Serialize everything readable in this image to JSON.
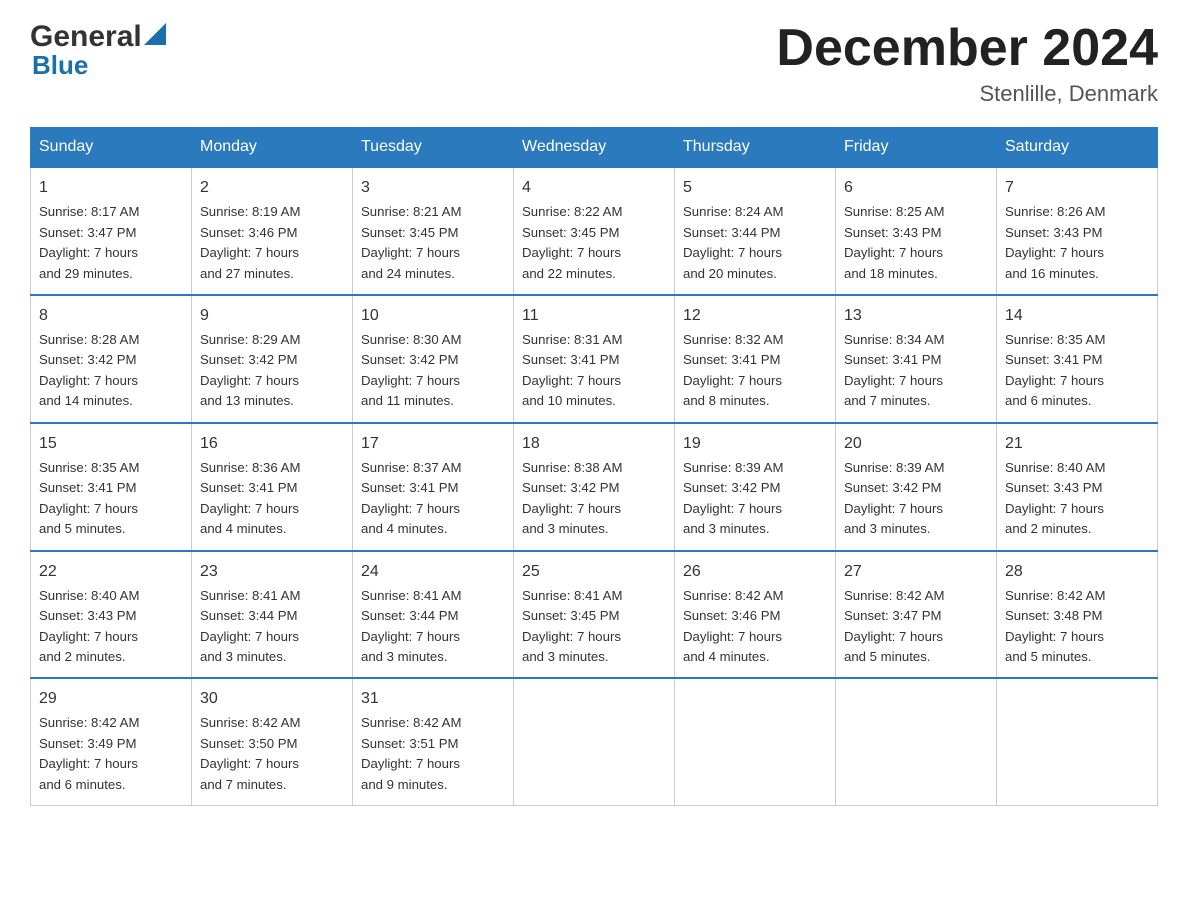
{
  "header": {
    "logo_general": "General",
    "logo_blue": "Blue",
    "month_title": "December 2024",
    "location": "Stenlille, Denmark"
  },
  "days_of_week": [
    "Sunday",
    "Monday",
    "Tuesday",
    "Wednesday",
    "Thursday",
    "Friday",
    "Saturday"
  ],
  "weeks": [
    [
      {
        "day": "1",
        "sunrise": "8:17 AM",
        "sunset": "3:47 PM",
        "daylight": "7 hours and 29 minutes."
      },
      {
        "day": "2",
        "sunrise": "8:19 AM",
        "sunset": "3:46 PM",
        "daylight": "7 hours and 27 minutes."
      },
      {
        "day": "3",
        "sunrise": "8:21 AM",
        "sunset": "3:45 PM",
        "daylight": "7 hours and 24 minutes."
      },
      {
        "day": "4",
        "sunrise": "8:22 AM",
        "sunset": "3:45 PM",
        "daylight": "7 hours and 22 minutes."
      },
      {
        "day": "5",
        "sunrise": "8:24 AM",
        "sunset": "3:44 PM",
        "daylight": "7 hours and 20 minutes."
      },
      {
        "day": "6",
        "sunrise": "8:25 AM",
        "sunset": "3:43 PM",
        "daylight": "7 hours and 18 minutes."
      },
      {
        "day": "7",
        "sunrise": "8:26 AM",
        "sunset": "3:43 PM",
        "daylight": "7 hours and 16 minutes."
      }
    ],
    [
      {
        "day": "8",
        "sunrise": "8:28 AM",
        "sunset": "3:42 PM",
        "daylight": "7 hours and 14 minutes."
      },
      {
        "day": "9",
        "sunrise": "8:29 AM",
        "sunset": "3:42 PM",
        "daylight": "7 hours and 13 minutes."
      },
      {
        "day": "10",
        "sunrise": "8:30 AM",
        "sunset": "3:42 PM",
        "daylight": "7 hours and 11 minutes."
      },
      {
        "day": "11",
        "sunrise": "8:31 AM",
        "sunset": "3:41 PM",
        "daylight": "7 hours and 10 minutes."
      },
      {
        "day": "12",
        "sunrise": "8:32 AM",
        "sunset": "3:41 PM",
        "daylight": "7 hours and 8 minutes."
      },
      {
        "day": "13",
        "sunrise": "8:34 AM",
        "sunset": "3:41 PM",
        "daylight": "7 hours and 7 minutes."
      },
      {
        "day": "14",
        "sunrise": "8:35 AM",
        "sunset": "3:41 PM",
        "daylight": "7 hours and 6 minutes."
      }
    ],
    [
      {
        "day": "15",
        "sunrise": "8:35 AM",
        "sunset": "3:41 PM",
        "daylight": "7 hours and 5 minutes."
      },
      {
        "day": "16",
        "sunrise": "8:36 AM",
        "sunset": "3:41 PM",
        "daylight": "7 hours and 4 minutes."
      },
      {
        "day": "17",
        "sunrise": "8:37 AM",
        "sunset": "3:41 PM",
        "daylight": "7 hours and 4 minutes."
      },
      {
        "day": "18",
        "sunrise": "8:38 AM",
        "sunset": "3:42 PM",
        "daylight": "7 hours and 3 minutes."
      },
      {
        "day": "19",
        "sunrise": "8:39 AM",
        "sunset": "3:42 PM",
        "daylight": "7 hours and 3 minutes."
      },
      {
        "day": "20",
        "sunrise": "8:39 AM",
        "sunset": "3:42 PM",
        "daylight": "7 hours and 3 minutes."
      },
      {
        "day": "21",
        "sunrise": "8:40 AM",
        "sunset": "3:43 PM",
        "daylight": "7 hours and 2 minutes."
      }
    ],
    [
      {
        "day": "22",
        "sunrise": "8:40 AM",
        "sunset": "3:43 PM",
        "daylight": "7 hours and 2 minutes."
      },
      {
        "day": "23",
        "sunrise": "8:41 AM",
        "sunset": "3:44 PM",
        "daylight": "7 hours and 3 minutes."
      },
      {
        "day": "24",
        "sunrise": "8:41 AM",
        "sunset": "3:44 PM",
        "daylight": "7 hours and 3 minutes."
      },
      {
        "day": "25",
        "sunrise": "8:41 AM",
        "sunset": "3:45 PM",
        "daylight": "7 hours and 3 minutes."
      },
      {
        "day": "26",
        "sunrise": "8:42 AM",
        "sunset": "3:46 PM",
        "daylight": "7 hours and 4 minutes."
      },
      {
        "day": "27",
        "sunrise": "8:42 AM",
        "sunset": "3:47 PM",
        "daylight": "7 hours and 5 minutes."
      },
      {
        "day": "28",
        "sunrise": "8:42 AM",
        "sunset": "3:48 PM",
        "daylight": "7 hours and 5 minutes."
      }
    ],
    [
      {
        "day": "29",
        "sunrise": "8:42 AM",
        "sunset": "3:49 PM",
        "daylight": "7 hours and 6 minutes."
      },
      {
        "day": "30",
        "sunrise": "8:42 AM",
        "sunset": "3:50 PM",
        "daylight": "7 hours and 7 minutes."
      },
      {
        "day": "31",
        "sunrise": "8:42 AM",
        "sunset": "3:51 PM",
        "daylight": "7 hours and 9 minutes."
      },
      null,
      null,
      null,
      null
    ]
  ],
  "labels": {
    "sunrise": "Sunrise:",
    "sunset": "Sunset:",
    "daylight": "Daylight:"
  }
}
